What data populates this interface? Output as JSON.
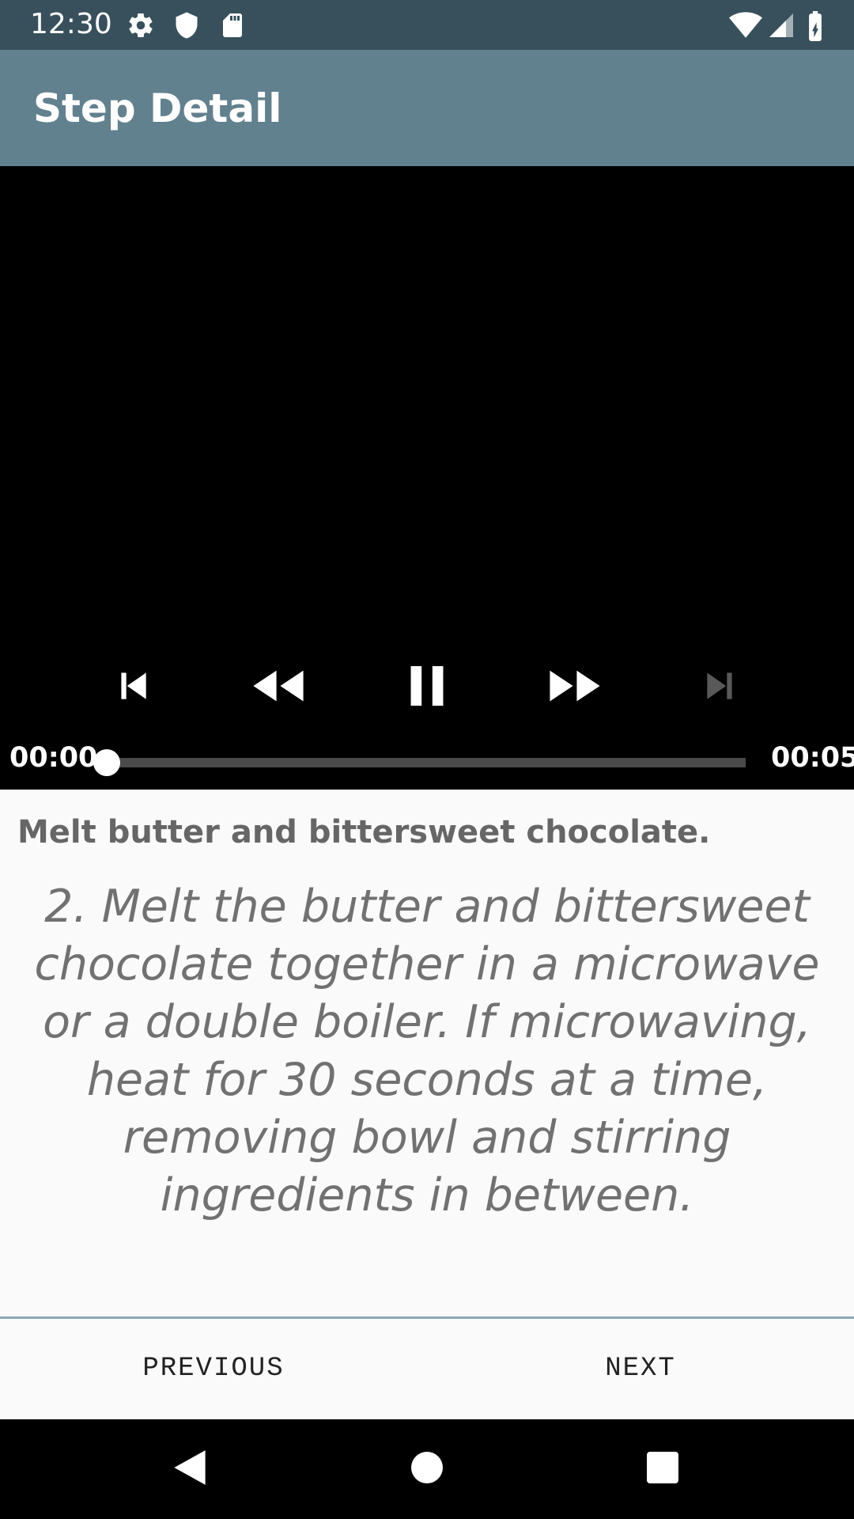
{
  "status_bar": {
    "time": "12:30",
    "left_icons": [
      "gear-icon",
      "shield-icon",
      "sd-card-icon"
    ],
    "right_icons": [
      "wifi-icon",
      "signal-icon",
      "battery-charging-icon"
    ]
  },
  "app_bar": {
    "title": "Step Detail"
  },
  "player": {
    "controls": [
      "skip-previous-icon",
      "rewind-icon",
      "pause-icon",
      "fast-forward-icon",
      "skip-next-icon"
    ],
    "position": "00:00",
    "duration": "00:05",
    "progress_fraction": 0.0
  },
  "step": {
    "short_description": "Melt butter and bittersweet chocolate.",
    "description": "2. Melt the butter and bittersweet chocolate together in a microwave or a double boiler. If microwaving, heat for 30 seconds at a time, removing bowl and stirring ingredients in between."
  },
  "navigation": {
    "previous_label": "PREVIOUS",
    "next_label": "NEXT"
  },
  "system_nav": {
    "icons": [
      "back-icon",
      "home-icon",
      "recents-icon"
    ]
  },
  "colors": {
    "status_bar": "#37505c",
    "app_bar": "#62818f",
    "player_background": "#000000",
    "divider": "#8ca6b6"
  }
}
